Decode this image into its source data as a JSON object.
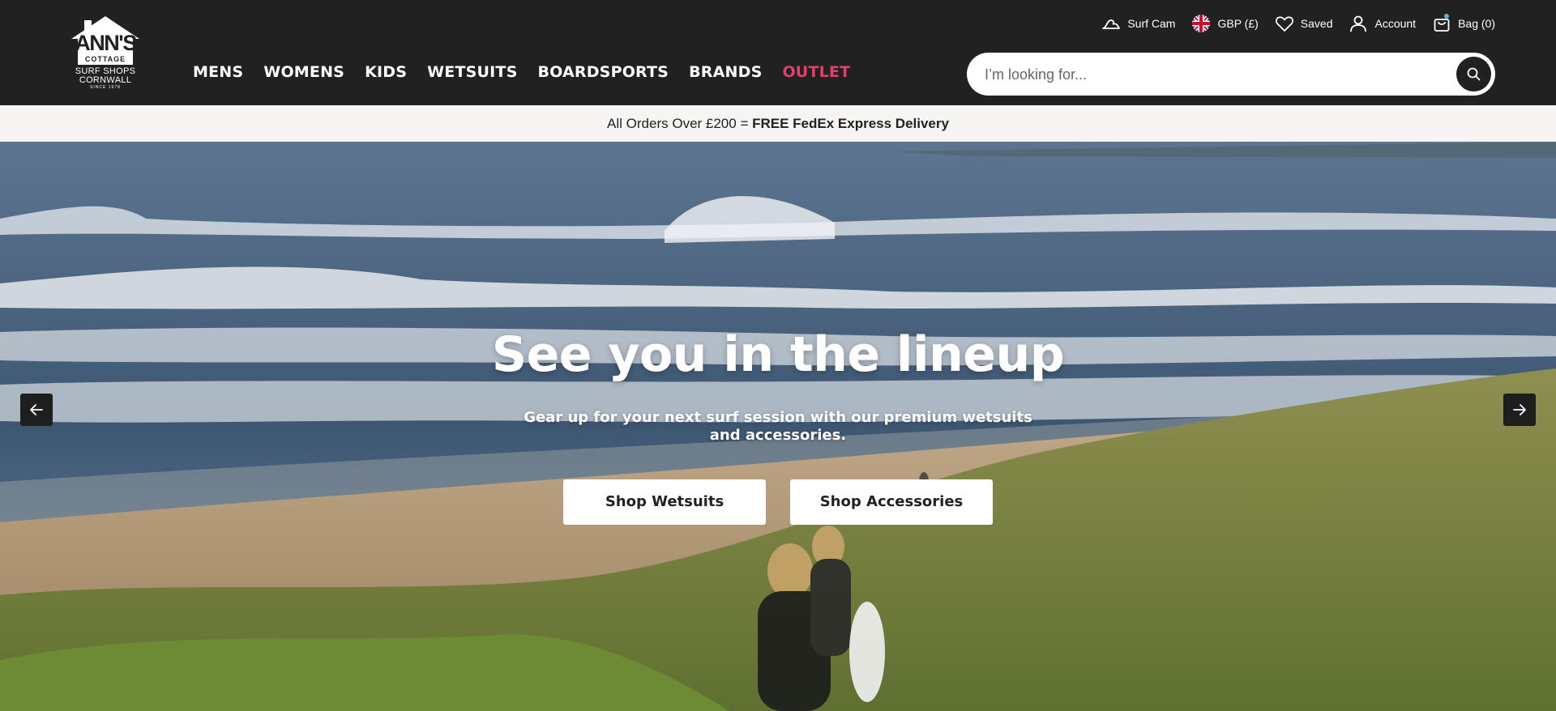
{
  "logo": {
    "main": "ANN'S",
    "line1": "COTTAGE",
    "line2": "SURF SHOPS",
    "line3": "CORNWALL",
    "line4": "SINCE 1978"
  },
  "nav": {
    "items": [
      {
        "label": "MENS"
      },
      {
        "label": "WOMENS"
      },
      {
        "label": "KIDS"
      },
      {
        "label": "WETSUITS"
      },
      {
        "label": "BOARDSPORTS"
      },
      {
        "label": "BRANDS"
      },
      {
        "label": "OUTLET"
      }
    ]
  },
  "utility": {
    "surf_cam": "Surf Cam",
    "currency": "GBP (£)",
    "saved": "Saved",
    "account": "Account",
    "bag": "Bag (0)"
  },
  "search": {
    "placeholder": "I’m looking for..."
  },
  "promo": {
    "text": "All Orders Over £200 = ",
    "bold": "FREE FedEx Express Delivery"
  },
  "hero": {
    "title": "See you in the lineup",
    "subtitle": "Gear up for your next surf session with our premium wetsuits and accessories.",
    "btn_wetsuits": "Shop Wetsuits",
    "btn_accessories": "Shop Accessories"
  },
  "colors": {
    "header_bg": "#212121",
    "outlet": "#e0406a",
    "promo_bg": "#f6f5f3"
  }
}
